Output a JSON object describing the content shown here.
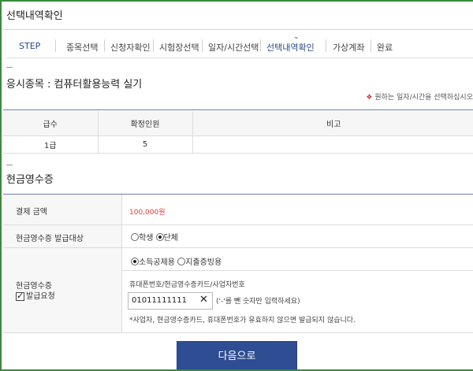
{
  "page_title": "선택내역확인",
  "steps": [
    {
      "label": "STEP"
    },
    {
      "label": "종목선택"
    },
    {
      "label": "신청자확인"
    },
    {
      "label": "시험장선택"
    },
    {
      "label": "일자/시간선택"
    },
    {
      "label": "선택내역확인"
    },
    {
      "label": "가상계좌"
    },
    {
      "label": "완료"
    }
  ],
  "exam_subject": "응시종목 : 컴퓨터활용능력 실기",
  "notice": {
    "marker": "❖",
    "text": "원하는 일자/시간을 선택하십시오"
  },
  "grade_table": {
    "headers": [
      "급수",
      "확정인원",
      "비고"
    ],
    "rows": [
      [
        "1급",
        "5",
        ""
      ]
    ]
  },
  "receipt_section_title": "현금영수증",
  "payment": {
    "amount_label": "결제 금액",
    "amount_value": "100,000원"
  },
  "receipt_target": {
    "label": "현금영수증 발급대상",
    "options": [
      {
        "label": "학생",
        "selected": false
      },
      {
        "label": "단체",
        "selected": true
      }
    ]
  },
  "receipt_request": {
    "label": "현금영수증",
    "checkbox_label": "발급요청",
    "checked": true,
    "usage_options": [
      {
        "label": "소득공제용",
        "selected": true
      },
      {
        "label": "지출증빙용",
        "selected": false
      }
    ],
    "number_caption": "휴대폰번호/현금영수증카드/사업자번호",
    "number_value": "01011111111",
    "number_help": "('-'를 뺀 숫자만 입력하세요)",
    "warning": "*사업자, 현금영수증카드, 휴대폰번호가 유효하지 않으면 발급되지 않습니다."
  },
  "next_button": "다음으로",
  "colors": {
    "accent": "#2e4d93",
    "amount": "#e53935",
    "frame": "#3a8a3a"
  }
}
